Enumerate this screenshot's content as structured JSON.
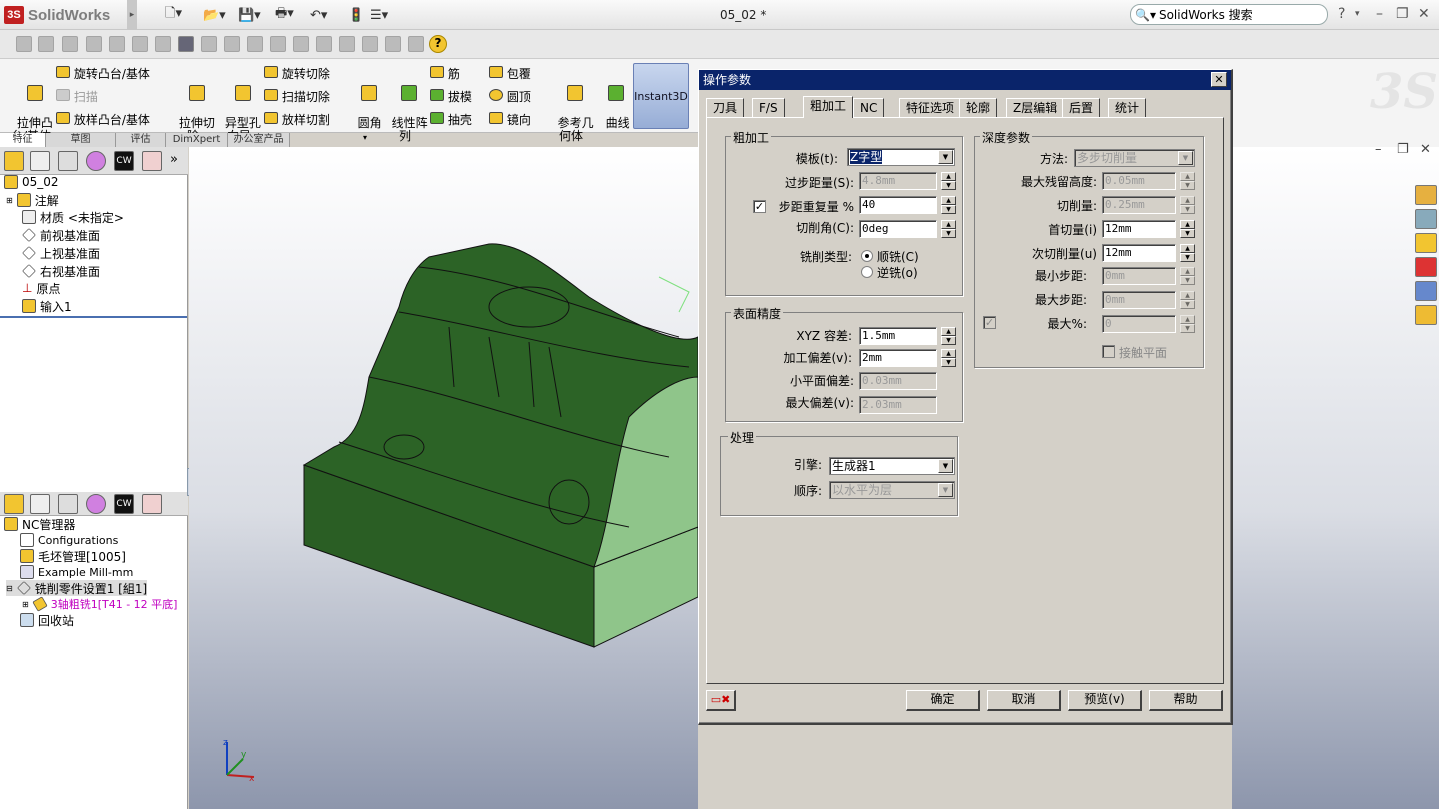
{
  "app": {
    "name": "SolidWorks",
    "doc_title": "05_02 *",
    "search_text": "SolidWorks 搜索"
  },
  "window_buttons": [
    "?",
    "–",
    "❐",
    "✕"
  ],
  "command_manager": {
    "big": [
      {
        "label": "拉伸凸\n台/基体"
      },
      {
        "label": "拉伸切\n除"
      },
      {
        "label": "异型孔\n向导"
      },
      {
        "label": "圆角"
      },
      {
        "label": "线性阵\n列"
      },
      {
        "label": "参考几\n何体"
      },
      {
        "label": "曲线"
      }
    ],
    "small": [
      {
        "label": "旋转凸台/基体"
      },
      {
        "label": "扫描"
      },
      {
        "label": "放样凸台/基体"
      },
      {
        "label": "旋转切除"
      },
      {
        "label": "扫描切除"
      },
      {
        "label": "放样切割"
      },
      {
        "label": "筋"
      },
      {
        "label": "拔模"
      },
      {
        "label": "抽壳"
      },
      {
        "label": "包覆"
      },
      {
        "label": "圆顶"
      },
      {
        "label": "镜向"
      }
    ],
    "instant3d": "Instant3D",
    "tabs": [
      "特征",
      "草图",
      "评估",
      "DimXpert",
      "办公室产品"
    ]
  },
  "feature_tree": {
    "root": "05_02",
    "items": [
      "注解",
      "材质 <未指定>",
      "前视基准面",
      "上视基准面",
      "右视基准面",
      "原点",
      "输入1"
    ]
  },
  "nc_tree": {
    "root": "NC管理器",
    "items": [
      "Configurations",
      "毛坯管理[1005]",
      "Example Mill-mm",
      "铣削零件设置1 [組1]",
      "3轴粗铣1[T41 - 12 平底]",
      "回收站"
    ]
  },
  "dialog": {
    "title": "操作参数",
    "tabs": [
      "刀具",
      "F/S",
      "粗加工",
      "NC",
      "特征选项",
      "轮廓",
      "Z层编辑",
      "后置",
      "统计"
    ],
    "rough": {
      "group": "粗加工",
      "template_label": "模板(t):",
      "template_value": "Z字型",
      "stepover_label": "过步距量(S):",
      "stepover_value": "4.8mm",
      "overlap_label": "步距重复量 %",
      "overlap_value": "40",
      "overlap_checked": "✓",
      "angle_label": "切削角(C):",
      "angle_value": "0deg",
      "type_label": "铣削类型:",
      "climb": "顺铣(C)",
      "conv": "逆铣(o)"
    },
    "surface": {
      "group": "表面精度",
      "xyz_label": "XYZ 容差:",
      "xyz_value": "1.5mm",
      "allow_label": "加工偏差(v):",
      "allow_value": "2mm",
      "flat_label": "小平面偏差:",
      "flat_value": "0.03mm",
      "max_label": "最大偏差(v):",
      "max_value": "2.03mm"
    },
    "process": {
      "group": "处理",
      "engine_label": "引擎:",
      "engine_value": "生成器1",
      "order_label": "顺序:",
      "order_value": "以水平为层"
    },
    "depth": {
      "group": "深度参数",
      "method_label": "方法:",
      "method_value": "多步切削量",
      "scallop_label": "最大残留高度:",
      "scallop_value": "0.05mm",
      "cut_label": "切削量:",
      "cut_value": "0.25mm",
      "first_label": "首切量(i)",
      "first_value": "12mm",
      "next_label": "次切削量(u)",
      "next_value": "12mm",
      "minstep_label": "最小步距:",
      "minstep_value": "0mm",
      "maxstep_label": "最大步距:",
      "maxstep_value": "0mm",
      "maxpct_label": "最大%:",
      "maxpct_value": "0",
      "maxpct_checked": "✓",
      "contact_label": "接触平面"
    },
    "buttons": {
      "ok": "确定",
      "cancel": "取消",
      "preview": "预览(v)",
      "help": "帮助"
    }
  }
}
